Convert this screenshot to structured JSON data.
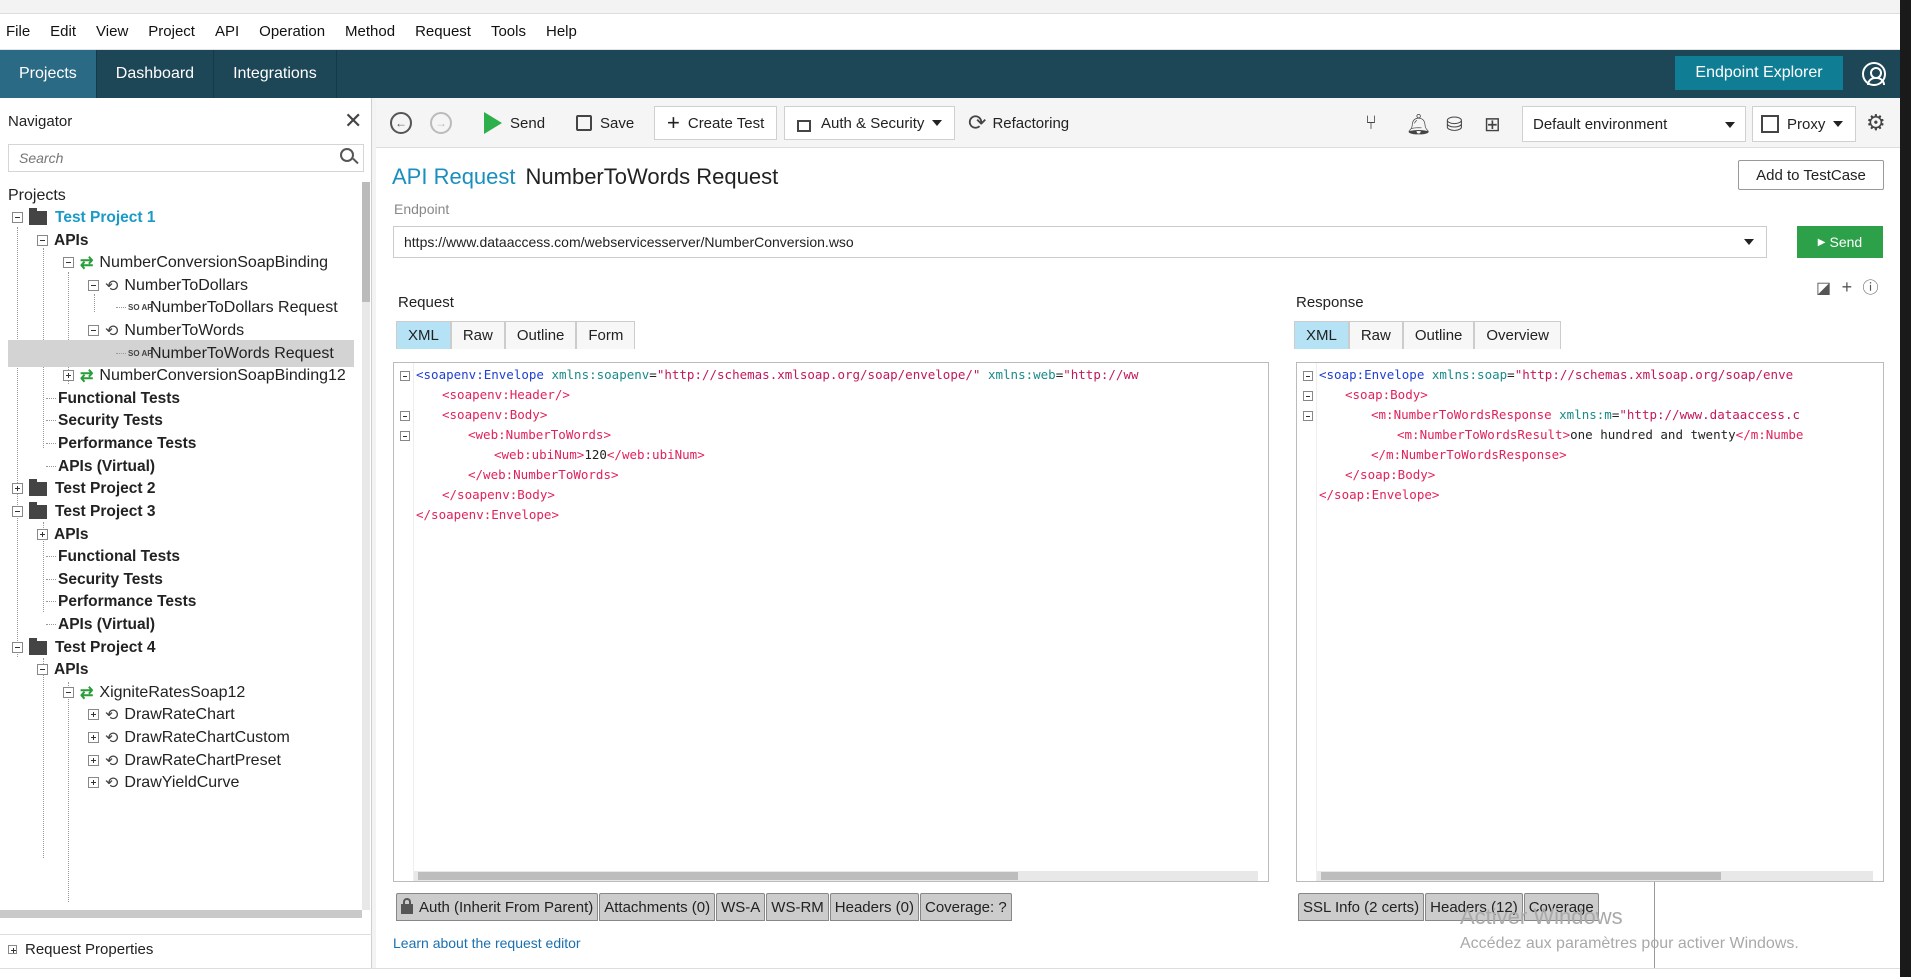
{
  "menu": [
    "File",
    "Edit",
    "View",
    "Project",
    "API",
    "Operation",
    "Method",
    "Request",
    "Tools",
    "Help"
  ],
  "topnav": {
    "tabs": [
      "Projects",
      "Dashboard",
      "Integrations"
    ],
    "endpoint_explorer": "Endpoint Explorer"
  },
  "navigator": {
    "title": "Navigator",
    "search_placeholder": "Search",
    "root": "Projects",
    "tree": [
      {
        "label": "Test Project 1"
      },
      {
        "label": "APIs"
      },
      {
        "label": "NumberConversionSoapBinding"
      },
      {
        "label": "NumberToDollars"
      },
      {
        "label": "NumberToDollars Request",
        "icon_text": "SO AP"
      },
      {
        "label": "NumberToWords"
      },
      {
        "label": "NumberToWords Request",
        "icon_text": "SO AP"
      },
      {
        "label": "NumberConversionSoapBinding12"
      },
      {
        "label": "Functional Tests"
      },
      {
        "label": "Security Tests"
      },
      {
        "label": "Performance Tests"
      },
      {
        "label": "APIs (Virtual)"
      },
      {
        "label": "Test Project 2"
      },
      {
        "label": "Test Project 3"
      },
      {
        "label": "APIs"
      },
      {
        "label": "Functional Tests"
      },
      {
        "label": "Security Tests"
      },
      {
        "label": "Performance Tests"
      },
      {
        "label": "APIs (Virtual)"
      },
      {
        "label": "Test Project 4"
      },
      {
        "label": "APIs"
      },
      {
        "label": "XigniteRatesSoap12"
      },
      {
        "label": "DrawRateChart"
      },
      {
        "label": "DrawRateChartCustom"
      },
      {
        "label": "DrawRateChartPreset"
      },
      {
        "label": "DrawYieldCurve"
      }
    ],
    "request_properties": "Request Properties"
  },
  "toolbar": {
    "send": "Send",
    "save": "Save",
    "create_test": "Create Test",
    "auth_security": "Auth & Security",
    "refactoring": "Refactoring",
    "environment": "Default environment",
    "proxy": "Proxy"
  },
  "request": {
    "type_label": "API Request",
    "name": "NumberToWords Request",
    "add_to_testcase": "Add to TestCase",
    "endpoint_label": "Endpoint",
    "endpoint_url": "https://www.dataaccess.com/webservicesserver/NumberConversion.wso",
    "send_label": "Send"
  },
  "request_pane": {
    "title": "Request",
    "tabs": [
      "XML",
      "Raw",
      "Outline",
      "Form"
    ],
    "xml": {
      "l1_tag": "<soapenv:Envelope",
      "l1_a1": " xmlns:soapenv",
      "l1_eq1": "=",
      "l1_v1": "\"http://schemas.xmlsoap.org/soap/envelope/\"",
      "l1_a2": " xmlns:web",
      "l1_eq2": "=",
      "l1_v2": "\"http://ww",
      "l2": "<soapenv:Header/>",
      "l3": "<soapenv:Body>",
      "l4": "<web:NumberToWords>",
      "l5_open": "<web:ubiNum>",
      "l5_val": "120",
      "l5_close": "</web:ubiNum>",
      "l6": "</web:NumberToWords>",
      "l7": "</soapenv:Body>",
      "l8": "</soapenv:Envelope>"
    },
    "bottom_tabs": [
      "Auth (Inherit From Parent)",
      "Attachments (0)",
      "WS-A",
      "WS-RM",
      "Headers (0)",
      "Coverage: ?"
    ]
  },
  "response_pane": {
    "title": "Response",
    "tabs": [
      "XML",
      "Raw",
      "Outline",
      "Overview"
    ],
    "xml": {
      "l1_tag": "<soap:Envelope",
      "l1_a1": " xmlns:soap",
      "l1_eq1": "=",
      "l1_v1": "\"http://schemas.xmlsoap.org/soap/enve",
      "l2": "<soap:Body>",
      "l3_tag": "<m:NumberToWordsResponse",
      "l3_a": " xmlns:m",
      "l3_eq": "=",
      "l3_v": "\"http://www.dataaccess.c",
      "l4_open": "<m:NumberToWordsResult>",
      "l4_val": "one hundred and twenty",
      "l4_close": "</m:Numbe",
      "l5": "</m:NumberToWordsResponse>",
      "l6": "</soap:Body>",
      "l7": "</soap:Envelope>"
    },
    "bottom_tabs": [
      "SSL Info (2 certs)",
      "Headers (12)",
      "Coverage"
    ]
  },
  "learn_link": "Learn about the request editor",
  "watermark": {
    "line1": "Activer Windows",
    "line2": "Accédez aux paramètres pour activer Windows."
  }
}
